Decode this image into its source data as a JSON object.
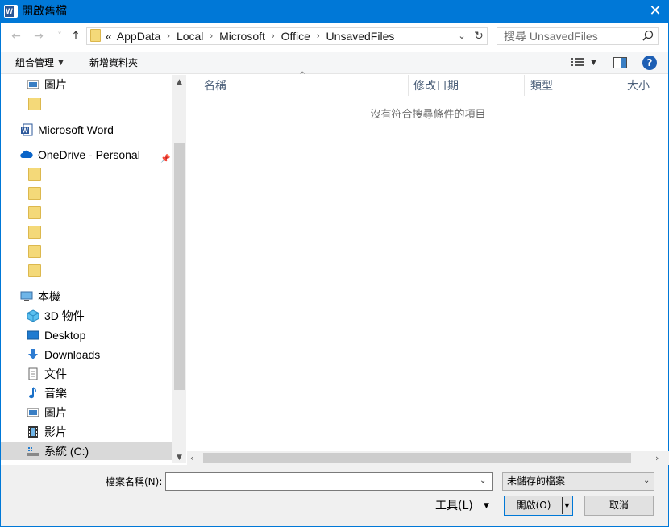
{
  "window": {
    "title": "開啟舊檔",
    "app_icon": "word-icon"
  },
  "nav": {
    "back": "←",
    "forward": "→",
    "recent": "˅",
    "up": "↑",
    "address": [
      "«",
      "AppData",
      "Local",
      "Microsoft",
      "Office",
      "UnsavedFiles"
    ],
    "search_placeholder": "搜尋 UnsavedFiles"
  },
  "toolbar": {
    "organize": "組合管理",
    "new_folder": "新增資料夾"
  },
  "sidebar": {
    "quick_items": [
      "圖片",
      "",
      "Microsoft Word",
      "OneDrive - Personal",
      "",
      "",
      "",
      "",
      "",
      ""
    ],
    "this_pc": "本機",
    "pc_items": [
      "3D 物件",
      "Desktop",
      "Downloads",
      "文件",
      "音樂",
      "圖片",
      "影片",
      "系統 (C:)"
    ]
  },
  "filelist": {
    "columns": [
      "名稱",
      "修改日期",
      "類型",
      "大小"
    ],
    "empty_message": "沒有符合搜尋條件的項目"
  },
  "bottom": {
    "filename_label": "檔案名稱(N):",
    "filename_value": "",
    "filetype": "未儲存的檔案",
    "tools": "工具(L)",
    "open": "開啟(O)",
    "cancel": "取消"
  },
  "colors": {
    "accent": "#0078d7",
    "folder": "#f4d979",
    "selected": "#d9d9d9"
  }
}
